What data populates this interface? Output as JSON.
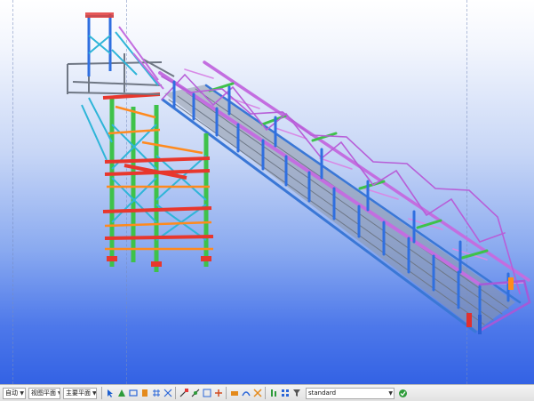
{
  "toolbar": {
    "combo_auto": "自动",
    "combo_view_plane": "视图平面",
    "combo_main_plane": "主要平面",
    "standard_select": "standard",
    "icons": [
      "select-arrow-icon",
      "snap-point-icon",
      "snap-line-icon",
      "snap-face-icon",
      "grid-snap-icon",
      "orthogonal-icon",
      "snap-end-icon",
      "snap-mid-icon",
      "snap-intersect-icon",
      "select-box-icon",
      "select-group-icon",
      "select-part-icon",
      "select-component-icon",
      "select-weld-icon",
      "select-bolt-icon",
      "filter-icon",
      "select-all-icon",
      "assembly-icon",
      "detail-icon"
    ]
  }
}
